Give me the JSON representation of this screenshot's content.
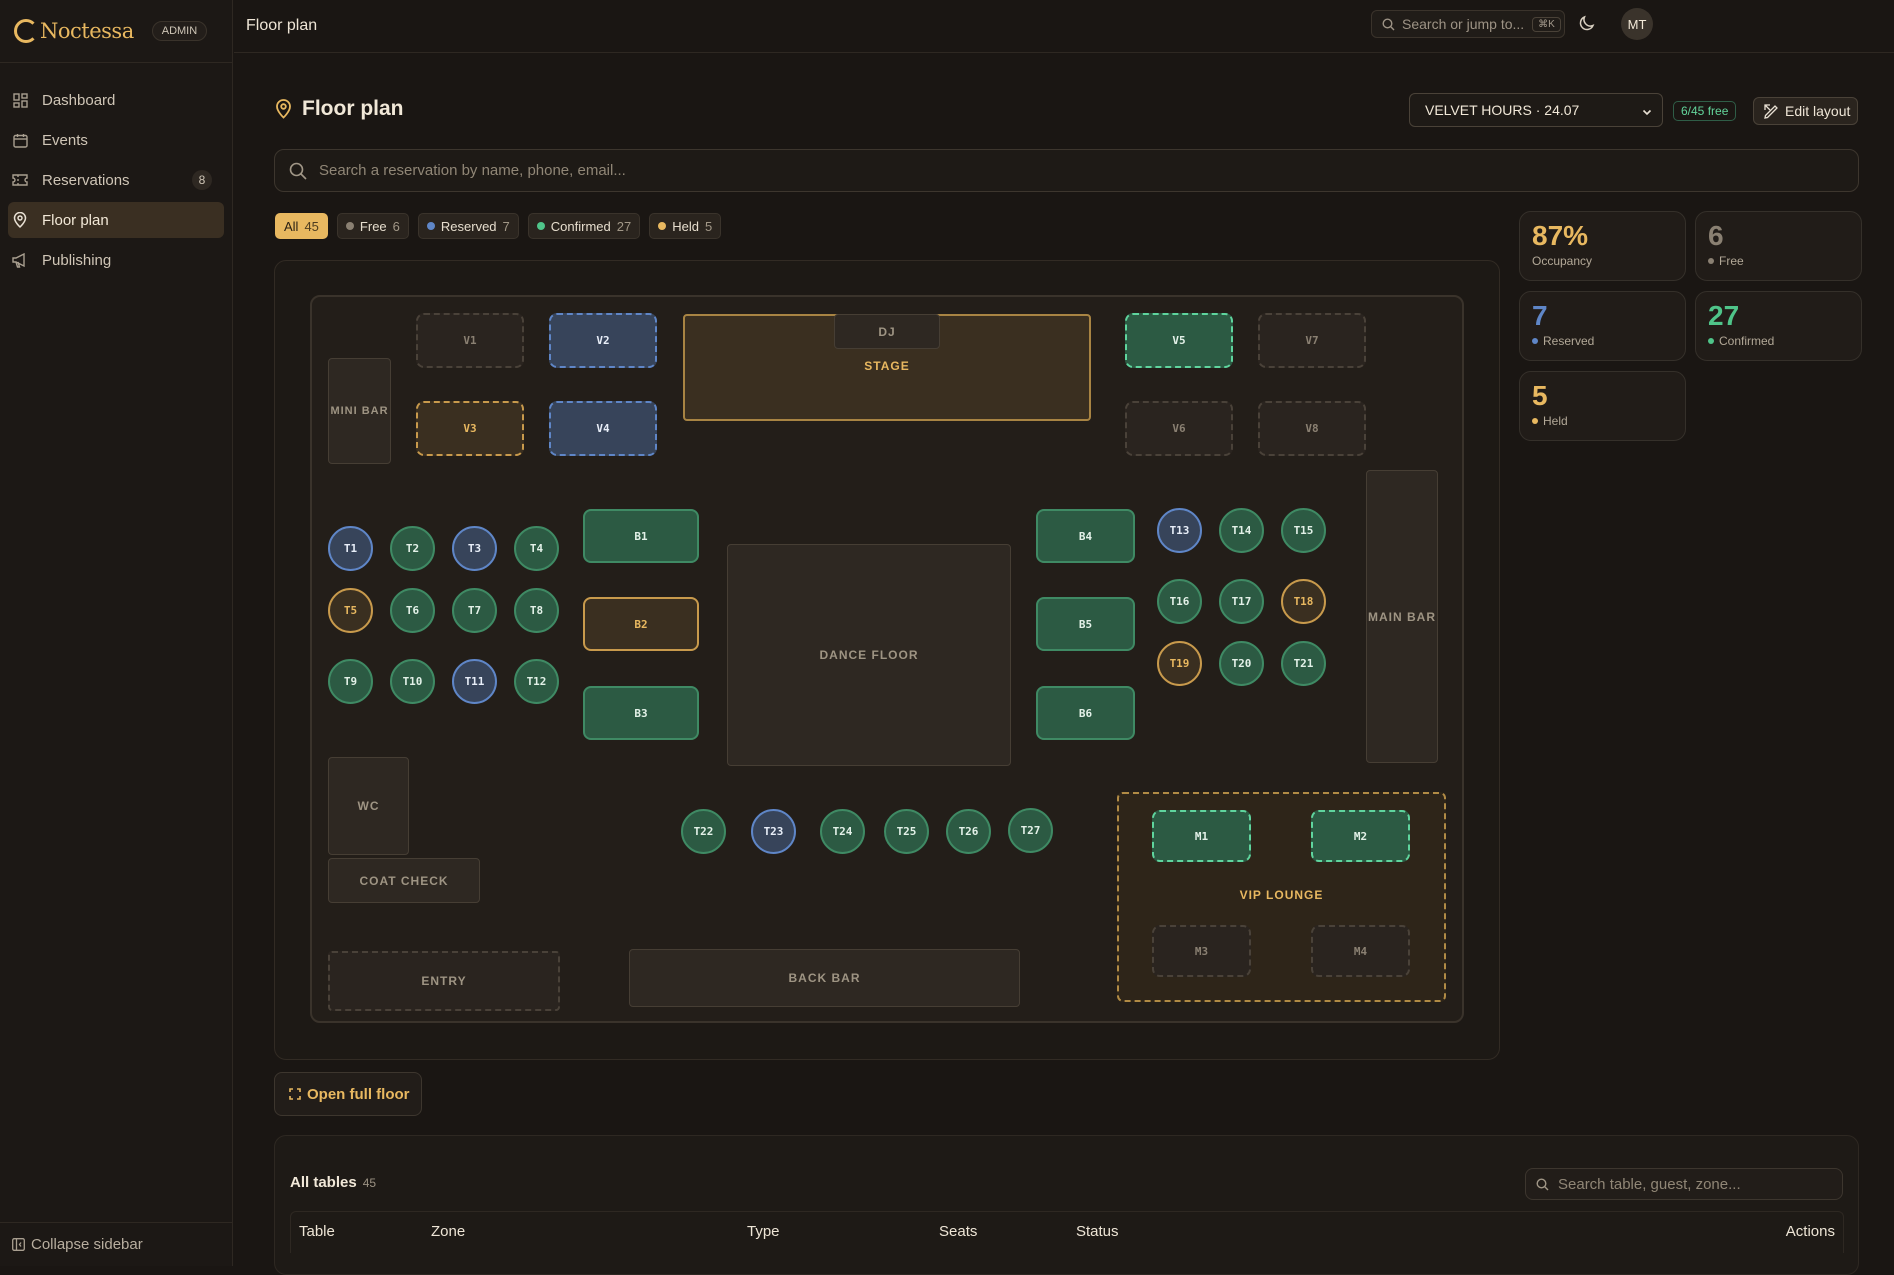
{
  "brand": {
    "name": "Noctessa",
    "badge": "ADMIN"
  },
  "nav": [
    {
      "label": "Dashboard",
      "icon": "dashboard-icon"
    },
    {
      "label": "Events",
      "icon": "calendar-icon"
    },
    {
      "label": "Reservations",
      "icon": "ticket-icon",
      "badge": "8"
    },
    {
      "label": "Floor plan",
      "icon": "map-pin-icon",
      "active": true
    },
    {
      "label": "Publishing",
      "icon": "megaphone-icon"
    }
  ],
  "collapse_label": "Collapse sidebar",
  "topbar": {
    "title": "Floor plan",
    "search_placeholder": "Search or jump to...",
    "shortcut": "⌘K",
    "avatar": "MT"
  },
  "page": {
    "title": "Floor plan",
    "event": "VELVET HOURS · 24.07",
    "free_pill": "6/45 free",
    "edit_label": "Edit layout",
    "search_placeholder": "Search a reservation by name, phone, email..."
  },
  "filters": [
    {
      "label": "All",
      "count": "45",
      "active": true
    },
    {
      "label": "Free",
      "count": "6",
      "dot": "#8a8072"
    },
    {
      "label": "Reserved",
      "count": "7",
      "dot": "#5f86c7"
    },
    {
      "label": "Confirmed",
      "count": "27",
      "dot": "#4fc489"
    },
    {
      "label": "Held",
      "count": "5",
      "dot": "#e8b860"
    }
  ],
  "stats": [
    {
      "value": "87%",
      "label": "Occupancy",
      "color": "#e8b860"
    },
    {
      "value": "6",
      "label": "Free",
      "color": "#8a8072",
      "dot": "#8a8072"
    },
    {
      "value": "7",
      "label": "Reserved",
      "color": "#5f86c7",
      "dot": "#5f86c7"
    },
    {
      "value": "27",
      "label": "Confirmed",
      "color": "#4fc489",
      "dot": "#4fc489"
    },
    {
      "value": "5",
      "label": "Held",
      "color": "#e8b860",
      "dot": "#e8b860"
    }
  ],
  "zones": {
    "mini_bar": "MINI BAR",
    "dj": "DJ",
    "stage": "STAGE",
    "dance_floor": "DANCE FLOOR",
    "main_bar": "MAIN BAR",
    "wc": "WC",
    "coat_check": "COAT CHECK",
    "entry": "ENTRY",
    "back_bar": "BACK BAR",
    "vip_lounge": "VIP LOUNGE"
  },
  "tables": [
    {
      "id": "V1",
      "status": "free"
    },
    {
      "id": "V2",
      "status": "reserved"
    },
    {
      "id": "V3",
      "status": "held"
    },
    {
      "id": "V4",
      "status": "reserved"
    },
    {
      "id": "V5",
      "status": "confirmed"
    },
    {
      "id": "V6",
      "status": "free"
    },
    {
      "id": "V7",
      "status": "free"
    },
    {
      "id": "V8",
      "status": "free"
    },
    {
      "id": "T1",
      "status": "reserved"
    },
    {
      "id": "T2",
      "status": "confirmed"
    },
    {
      "id": "T3",
      "status": "reserved"
    },
    {
      "id": "T4",
      "status": "confirmed"
    },
    {
      "id": "T5",
      "status": "held"
    },
    {
      "id": "T6",
      "status": "confirmed"
    },
    {
      "id": "T7",
      "status": "confirmed"
    },
    {
      "id": "T8",
      "status": "confirmed"
    },
    {
      "id": "T9",
      "status": "confirmed"
    },
    {
      "id": "T10",
      "status": "confirmed"
    },
    {
      "id": "T11",
      "status": "reserved"
    },
    {
      "id": "T12",
      "status": "confirmed"
    },
    {
      "id": "B1",
      "status": "confirmed"
    },
    {
      "id": "B2",
      "status": "held"
    },
    {
      "id": "B3",
      "status": "confirmed"
    },
    {
      "id": "B4",
      "status": "confirmed"
    },
    {
      "id": "B5",
      "status": "confirmed"
    },
    {
      "id": "B6",
      "status": "confirmed"
    },
    {
      "id": "T13",
      "status": "reserved"
    },
    {
      "id": "T14",
      "status": "confirmed"
    },
    {
      "id": "T15",
      "status": "confirmed"
    },
    {
      "id": "T16",
      "status": "confirmed"
    },
    {
      "id": "T17",
      "status": "confirmed"
    },
    {
      "id": "T18",
      "status": "held"
    },
    {
      "id": "T19",
      "status": "held"
    },
    {
      "id": "T20",
      "status": "confirmed"
    },
    {
      "id": "T21",
      "status": "confirmed"
    },
    {
      "id": "T22",
      "status": "confirmed"
    },
    {
      "id": "T23",
      "status": "reserved"
    },
    {
      "id": "T24",
      "status": "confirmed"
    },
    {
      "id": "T25",
      "status": "confirmed"
    },
    {
      "id": "T26",
      "status": "confirmed"
    },
    {
      "id": "T27",
      "status": "confirmed"
    },
    {
      "id": "M1",
      "status": "confirmed"
    },
    {
      "id": "M2",
      "status": "confirmed"
    },
    {
      "id": "M3",
      "status": "free"
    },
    {
      "id": "M4",
      "status": "free"
    }
  ],
  "open_full_floor": "Open full floor",
  "all_tables": {
    "title": "All tables",
    "count": "45",
    "search_placeholder": "Search table, guest, zone...",
    "columns": [
      "Table",
      "Zone",
      "Type",
      "Seats",
      "Status",
      "Actions"
    ]
  }
}
